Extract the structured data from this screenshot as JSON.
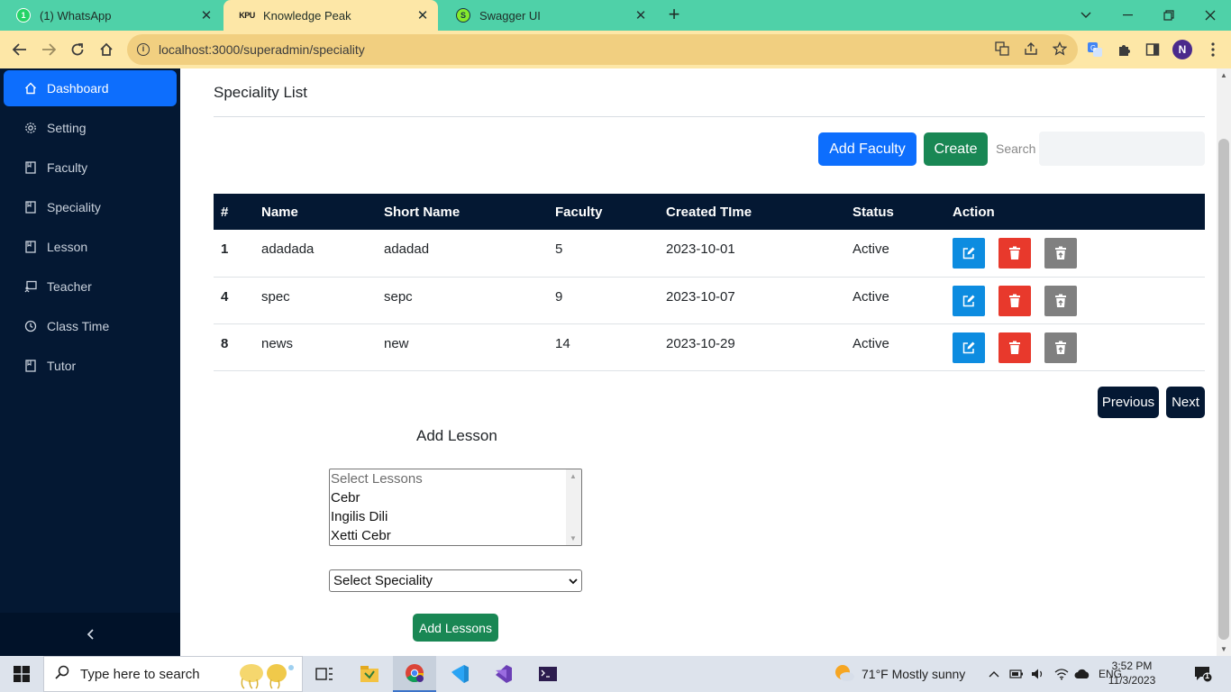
{
  "browser": {
    "tabs": [
      {
        "title": "(1) WhatsApp",
        "favicon": "whatsapp-icon",
        "favicon_text": "1"
      },
      {
        "title": "Knowledge Peak",
        "favicon": "kpu-logo",
        "favicon_text": "KPU"
      },
      {
        "title": "Swagger UI",
        "favicon": "swagger-icon",
        "favicon_text": "S"
      }
    ],
    "url": "localhost:3000/superadmin/speciality",
    "profile_initial": "N",
    "colors": {
      "tabstrip": "#4fd1a8",
      "active_tab": "#fde7a7",
      "omnibox": "#f1cf80"
    }
  },
  "sidebar": {
    "items": [
      {
        "label": "Dashboard",
        "icon": "home-icon",
        "active": true
      },
      {
        "label": "Setting",
        "icon": "gear-icon"
      },
      {
        "label": "Faculty",
        "icon": "bookmark-icon"
      },
      {
        "label": "Speciality",
        "icon": "bookmark-icon"
      },
      {
        "label": "Lesson",
        "icon": "bookmark-icon"
      },
      {
        "label": "Teacher",
        "icon": "chalkboard-icon"
      },
      {
        "label": "Class Time",
        "icon": "clock-icon"
      },
      {
        "label": "Tutor",
        "icon": "bookmark-icon"
      }
    ],
    "collapse_icon": "chevron-left-icon",
    "colors": {
      "background": "#041833",
      "active": "#0d6efd"
    }
  },
  "main": {
    "title": "Speciality List",
    "add_faculty_label": "Add Faculty",
    "create_label": "Create",
    "search_label": "Search",
    "search_value": "",
    "table": {
      "headers": [
        "#",
        "Name",
        "Short Name",
        "Faculty",
        "Created TIme",
        "Status",
        "Action"
      ],
      "rows": [
        {
          "id": "1",
          "name": "adadada",
          "short_name": "adadad",
          "faculty": "5",
          "created": "2023-10-01",
          "status": "Active"
        },
        {
          "id": "4",
          "name": "spec",
          "short_name": "sepc",
          "faculty": "9",
          "created": "2023-10-07",
          "status": "Active"
        },
        {
          "id": "8",
          "name": "news",
          "short_name": "new",
          "faculty": "14",
          "created": "2023-10-29",
          "status": "Active"
        }
      ],
      "action_icons": [
        "edit-icon",
        "trash-icon",
        "archive-icon"
      ]
    },
    "pagination": {
      "previous": "Previous",
      "next": "Next"
    },
    "add_lesson": {
      "heading": "Add Lesson",
      "lessons": [
        "Select Lessons",
        "Cebr",
        "Ingilis Dili",
        "Xetti Cebr"
      ],
      "speciality_select": "Select Speciality",
      "submit_label": "Add Lessons"
    }
  },
  "taskbar": {
    "search_placeholder": "Type here to search",
    "weather": "71°F  Mostly sunny",
    "language": "ENG",
    "time": "3:52 PM",
    "date": "11/3/2023",
    "notification_count": "1"
  }
}
